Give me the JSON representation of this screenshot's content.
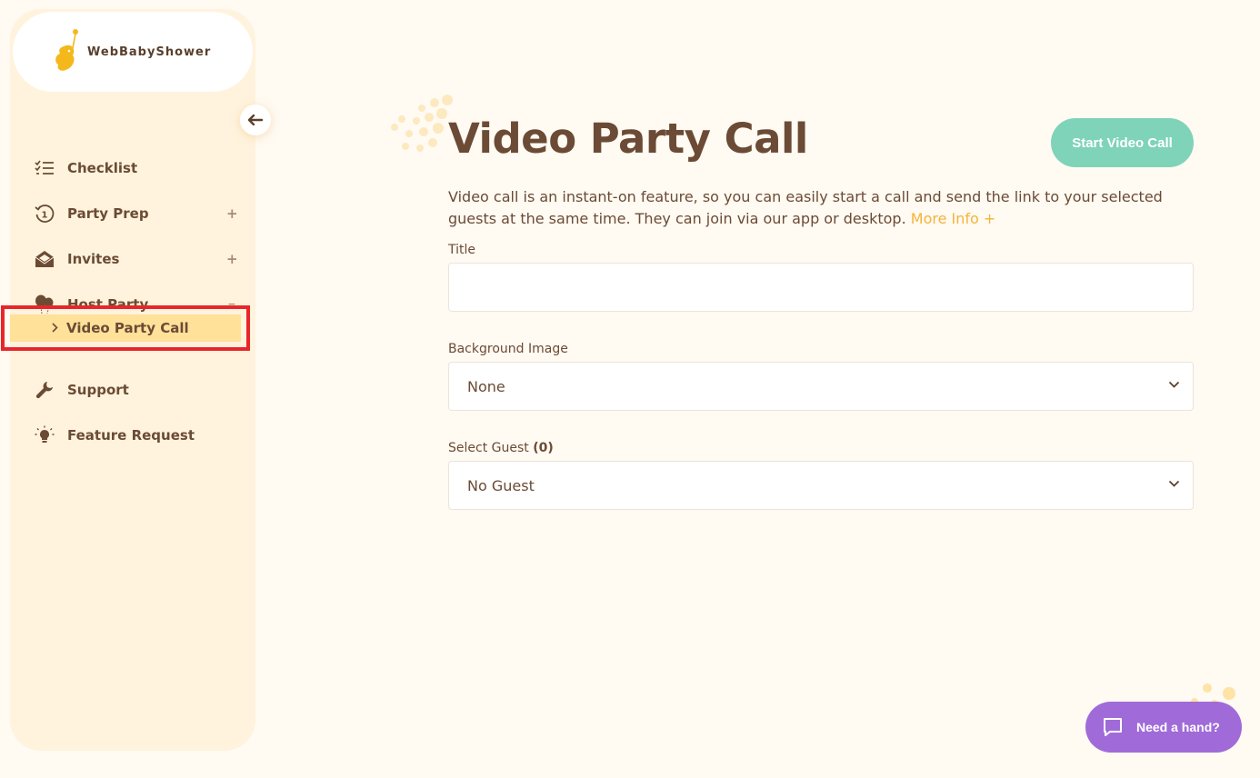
{
  "app": {
    "name": "WebBabyShower"
  },
  "colors": {
    "brand_brown": "#6b4b35",
    "accent_green": "#7fd3b8",
    "accent_yellow": "#f2b43a",
    "highlight": "#ffe19a",
    "help_purple": "#a06bd9",
    "selection_box": "#e8262a"
  },
  "sidebar": {
    "collapse_icon": "arrow-left-icon",
    "items": [
      {
        "label": "Checklist",
        "icon": "checklist-icon",
        "toggle": ""
      },
      {
        "label": "Party Prep",
        "icon": "countdown-icon",
        "toggle": "+"
      },
      {
        "label": "Invites",
        "icon": "envelope-icon",
        "toggle": "+"
      },
      {
        "label": "Host Party",
        "icon": "balloons-icon",
        "toggle": "−"
      },
      {
        "label": "Support",
        "icon": "wrench-icon",
        "toggle": ""
      },
      {
        "label": "Feature Request",
        "icon": "lightbulb-icon",
        "toggle": ""
      }
    ],
    "sub_item": {
      "label": "Video Party Call",
      "icon": "chevron-right-icon"
    }
  },
  "main": {
    "title": "Video Party Call",
    "start_button": "Start Video Call",
    "description": "Video call is an instant-on feature, so you can easily start a call and send the link to your selected guests at the same time. They can join via our app or desktop.",
    "more_info": "More Info +",
    "fields": {
      "title_label": "Title",
      "title_value": "",
      "background_label": "Background Image",
      "background_value": "None",
      "guest_label": "Select Guest",
      "guest_count": "(0)",
      "guest_value": "No Guest"
    }
  },
  "help": {
    "label": "Need a hand?",
    "icon": "chat-bubble-icon"
  }
}
